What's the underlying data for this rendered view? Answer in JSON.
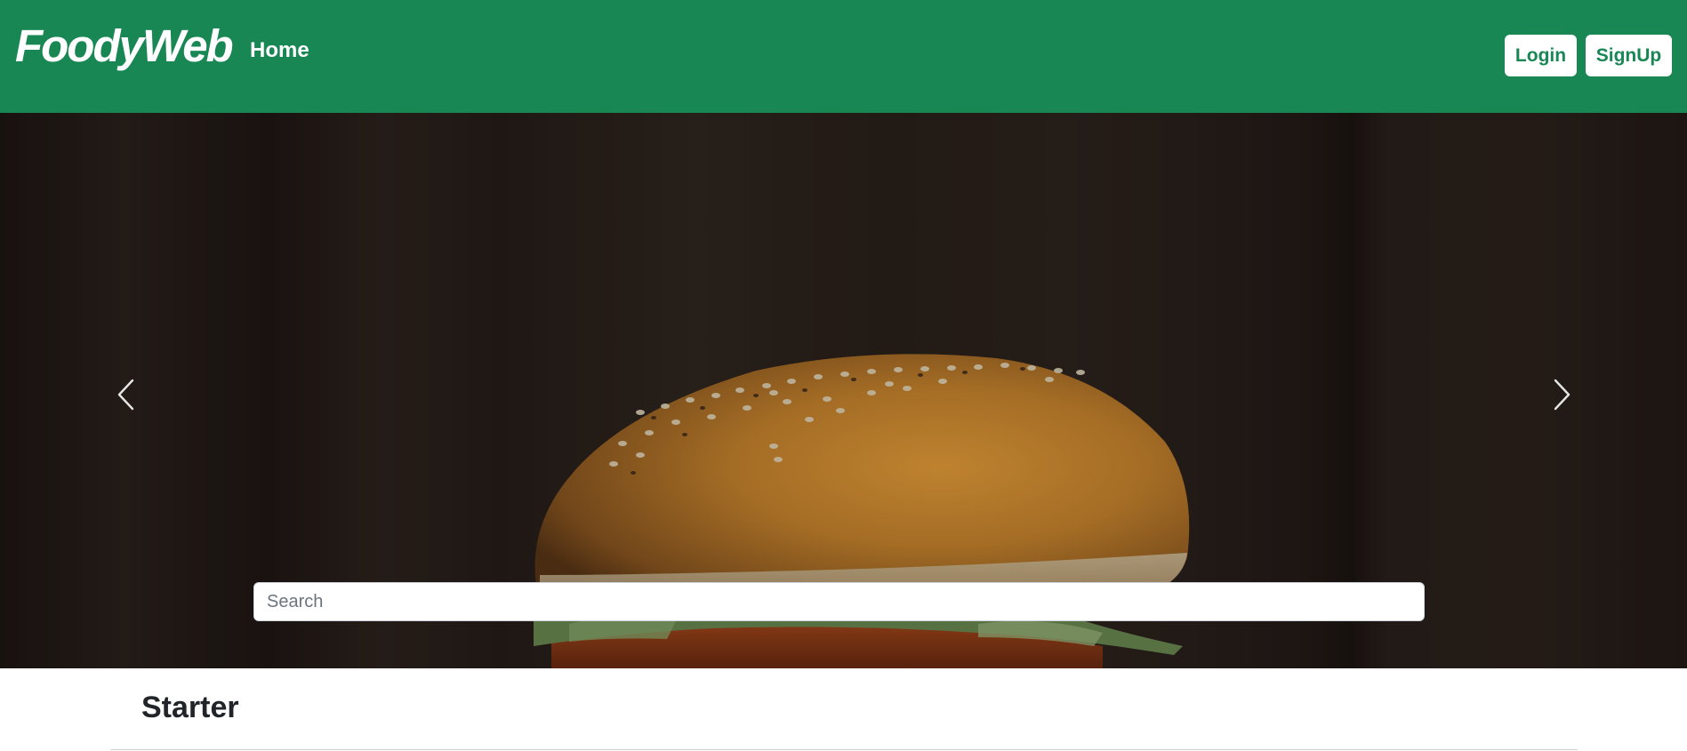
{
  "navbar": {
    "brand": "FoodyWeb",
    "home_label": "Home",
    "login_label": "Login",
    "signup_label": "SignUp",
    "background_color": "#198754"
  },
  "carousel": {
    "image_subject": "burger",
    "prev_icon": "chevron-left-icon",
    "next_icon": "chevron-right-icon"
  },
  "search": {
    "placeholder": "Search",
    "value": ""
  },
  "section": {
    "title": "Starter"
  }
}
